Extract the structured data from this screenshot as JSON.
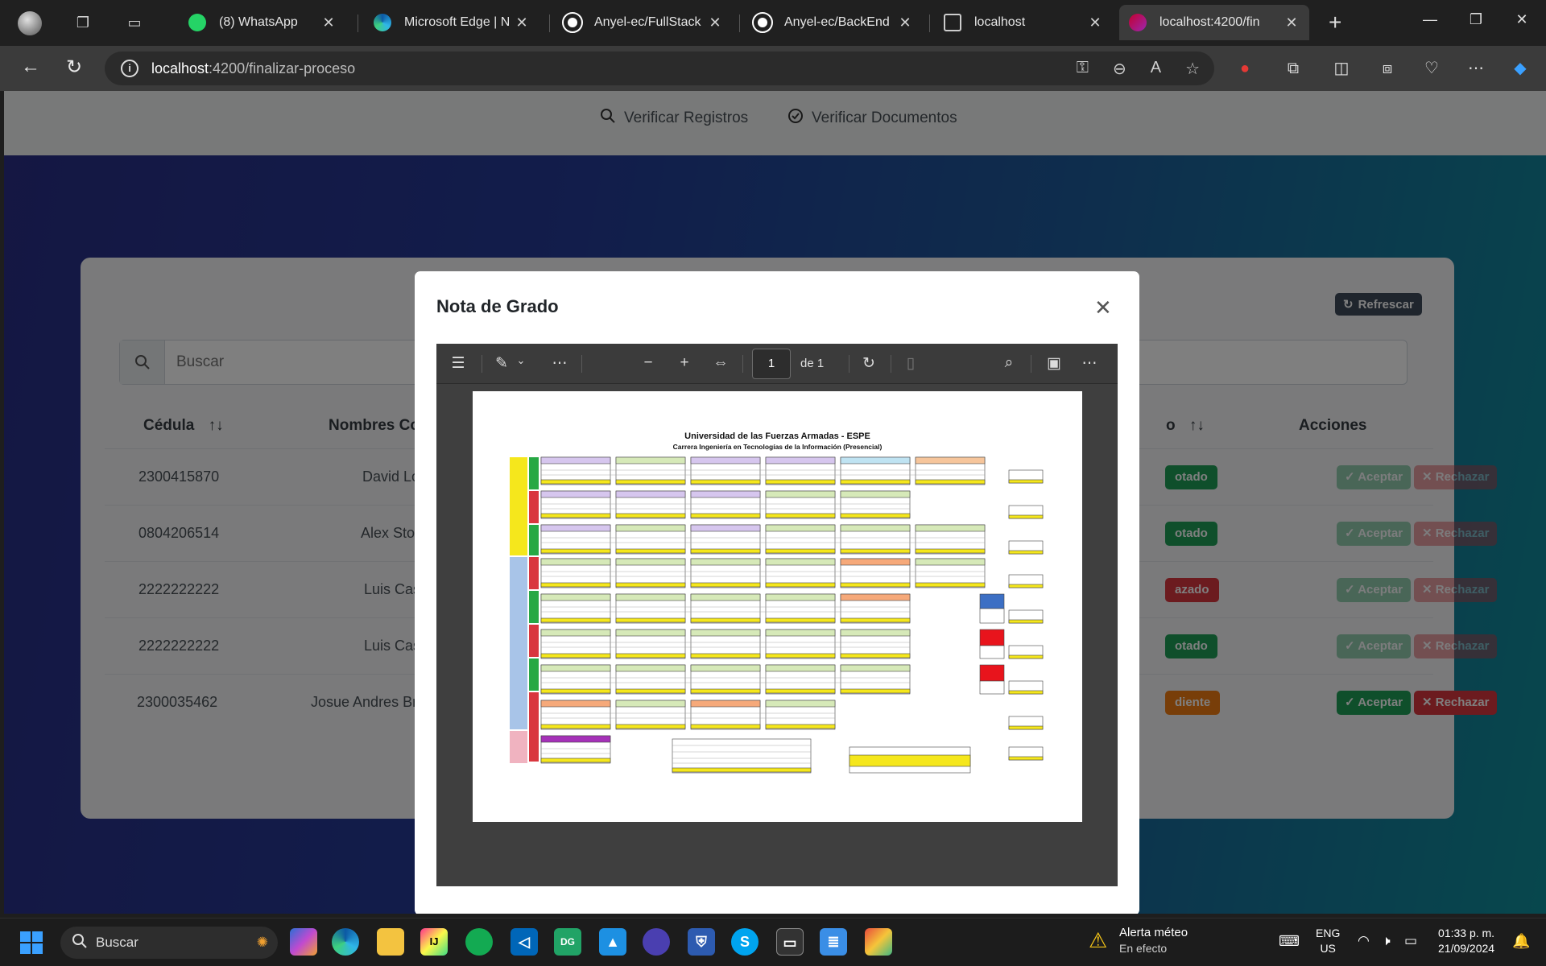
{
  "browser": {
    "tabs": [
      {
        "title": "(8) WhatsApp",
        "favicon": "whatsapp-icon",
        "color": "#25d366"
      },
      {
        "title": "Microsoft Edge | N",
        "favicon": "edge-icon",
        "color": "#2b8fd6"
      },
      {
        "title": "Anyel-ec/FullStack",
        "favicon": "github-icon",
        "color": "#ffffff"
      },
      {
        "title": "Anyel-ec/BackEnd",
        "favicon": "github-icon",
        "color": "#ffffff"
      },
      {
        "title": "localhost",
        "favicon": "page-icon",
        "color": "#cccccc"
      },
      {
        "title": "localhost:4200/fin",
        "favicon": "angular-icon",
        "color": "#c3002f"
      }
    ],
    "close_glyph": "✕",
    "url_host": "localhost",
    "url_path": ":4200/finalizar-proceso"
  },
  "app": {
    "nav": [
      {
        "label": "Verificar Registros",
        "icon": "search-icon"
      },
      {
        "label": "Verificar Documentos",
        "icon": "check-circle-icon"
      }
    ],
    "refresh_label": "Refrescar",
    "search_placeholder": "Buscar",
    "headers": {
      "cedula": "Cédula",
      "sort_glyph": "↑↓",
      "nombres": "Nombres Com",
      "estado": "o",
      "acciones": "Acciones"
    },
    "rows": [
      {
        "cedula": "2300415870",
        "nombre": "David Lo",
        "estado": "otado",
        "estado_color": "#1e9e57",
        "enabled": false
      },
      {
        "cedula": "0804206514",
        "nombre": "Alex Stop",
        "estado": "otado",
        "estado_color": "#1e9e57",
        "enabled": false
      },
      {
        "cedula": "2222222222",
        "nombre": "Luis Cas",
        "estado": "azado",
        "estado_color": "#d9363e",
        "enabled": false
      },
      {
        "cedula": "2222222222",
        "nombre": "Luis Cas",
        "estado": "otado",
        "estado_color": "#1e9e57",
        "enabled": false
      },
      {
        "cedula": "2300035462",
        "nombre": "Josue Andres Bra",
        "estado": "diente",
        "estado_color": "#f07c12",
        "enabled": true
      }
    ],
    "accept_label": "Aceptar",
    "reject_label": "Rechazar"
  },
  "modal": {
    "title": "Nota de Grado",
    "close_glyph": "✕",
    "pdf": {
      "page_number": "1",
      "page_of": "de 1",
      "doc_title": "Universidad de las Fuerzas Armadas - ESPE",
      "doc_subtitle": "Carrera Ingeniería en Tecnologías de la Información (Presencial)"
    }
  },
  "taskbar": {
    "search_label": "Buscar",
    "weather_title": "Alerta méteo",
    "weather_sub": "En efecto",
    "lang_1": "ENG",
    "lang_2": "US",
    "time": "01:33 p. m.",
    "date": "21/09/2024"
  }
}
